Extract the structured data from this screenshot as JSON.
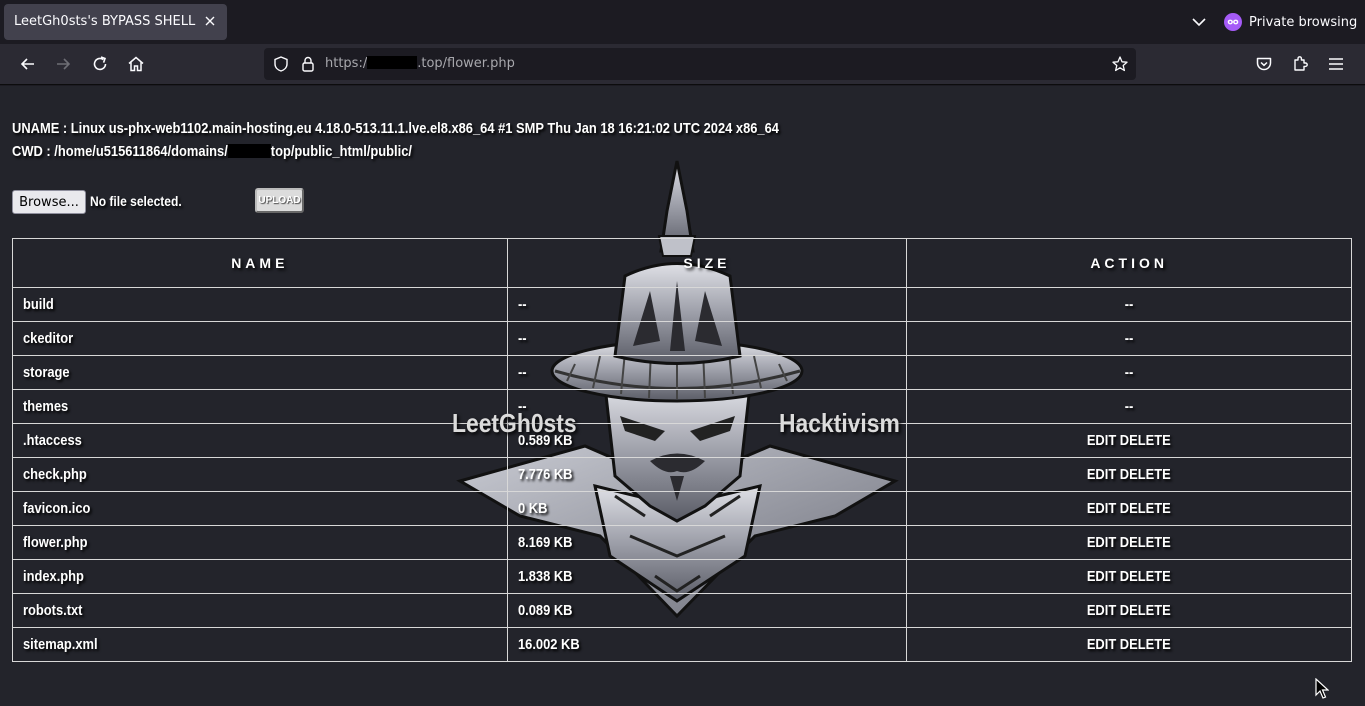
{
  "browser": {
    "tab_title": "LeetGh0sts's BYPASS SHELL",
    "private_label": "Private browsing",
    "url_prefix": "https:/",
    "url_suffix": ".top/flower.php"
  },
  "shell": {
    "uname_label": "UNAME : Linux us-phx-web1102.main-hosting.eu 4.18.0-513.11.1.lve.el8.x86_64 #1 SMP Thu Jan 18 16:21:02 UTC 2024 x86_64",
    "cwd_prefix": "CWD : /home/u515611864/domains/",
    "cwd_suffix": "top/public_html/public/",
    "browse_label": "Browse...",
    "no_file_label": "No file selected.",
    "upload_label": "UPLOAD",
    "watermark_left": "LeetGh0sts",
    "watermark_right": "Hacktivism"
  },
  "table": {
    "headers": [
      "NAME",
      "SIZE",
      "ACTION"
    ],
    "rows": [
      {
        "name": "build",
        "size": "--",
        "action": "--"
      },
      {
        "name": "ckeditor",
        "size": "--",
        "action": "--"
      },
      {
        "name": "storage",
        "size": "--",
        "action": "--"
      },
      {
        "name": "themes",
        "size": "--",
        "action": "--"
      },
      {
        "name": ".htaccess",
        "size": "0.589 KB",
        "action": "EDIT DELETE"
      },
      {
        "name": "check.php",
        "size": "7.776 KB",
        "action": "EDIT DELETE"
      },
      {
        "name": "favicon.ico",
        "size": "0 KB",
        "action": "EDIT DELETE"
      },
      {
        "name": "flower.php",
        "size": "8.169 KB",
        "action": "EDIT DELETE"
      },
      {
        "name": "index.php",
        "size": "1.838 KB",
        "action": "EDIT DELETE"
      },
      {
        "name": "robots.txt",
        "size": "0.089 KB",
        "action": "EDIT DELETE"
      },
      {
        "name": "sitemap.xml",
        "size": "16.002 KB",
        "action": "EDIT DELETE"
      }
    ]
  },
  "icons": [
    "close-icon",
    "chevron-down-icon",
    "private-mask-icon",
    "back-icon",
    "forward-icon",
    "reload-icon",
    "home-icon",
    "shield-icon",
    "lock-icon",
    "star-icon",
    "pocket-icon",
    "extensions-icon",
    "menu-icon",
    "cursor-icon"
  ]
}
